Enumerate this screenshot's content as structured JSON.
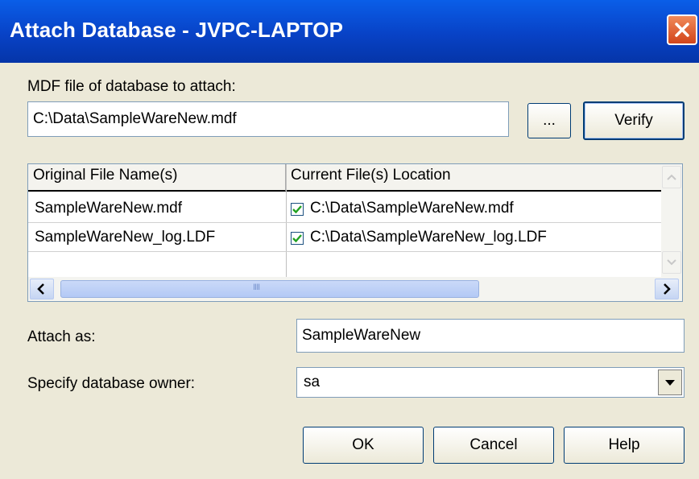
{
  "window": {
    "title": "Attach Database - JVPC-LAPTOP"
  },
  "mdf": {
    "label": "MDF file of database to attach:",
    "path": "C:\\Data\\SampleWareNew.mdf",
    "browse_label": "...",
    "verify_label": "Verify"
  },
  "files_grid": {
    "columns": [
      "Original File Name(s)",
      "Current File(s) Location"
    ],
    "rows": [
      {
        "original": "SampleWareNew.mdf",
        "checked": true,
        "location": "C:\\Data\\SampleWareNew.mdf"
      },
      {
        "original": "SampleWareNew_log.LDF",
        "checked": true,
        "location": "C:\\Data\\SampleWareNew_log.LDF"
      }
    ],
    "scroll_grip": "IIII"
  },
  "attach_as": {
    "label": "Attach as:",
    "value": "SampleWareNew"
  },
  "owner": {
    "label": "Specify database owner:",
    "value": "sa"
  },
  "buttons": {
    "ok": "OK",
    "cancel": "Cancel",
    "help": "Help"
  },
  "icons": {
    "close": "close-icon",
    "checkbox": "checkbox-checked-icon",
    "dropdown": "chevron-down-icon"
  },
  "colors": {
    "titlebar": "#0842c6",
    "dialog_bg": "#ece9d8",
    "close_button": "#d2451b"
  }
}
